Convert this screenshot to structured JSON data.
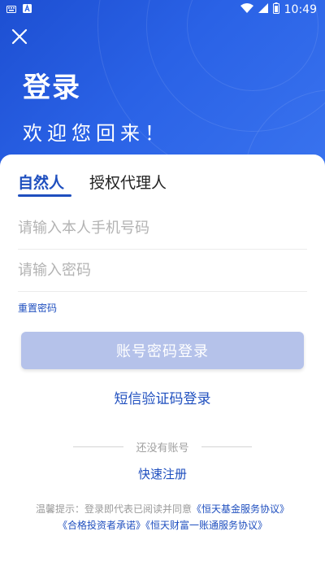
{
  "status_bar": {
    "time": "10:49"
  },
  "header": {
    "title": "登录",
    "subtitle": "欢迎您回来！"
  },
  "tabs": [
    {
      "label": "自然人",
      "active": true
    },
    {
      "label": "授权代理人",
      "active": false
    }
  ],
  "form": {
    "phone_placeholder": "请输入本人手机号码",
    "password_placeholder": "请输入密码",
    "reset_password": "重置密码",
    "login_button": "账号密码登录",
    "sms_login": "短信验证码登录"
  },
  "register": {
    "prompt": "还没有账号",
    "link": "快速注册"
  },
  "agreement": {
    "prefix": "温馨提示：登录即代表已阅读并同意",
    "link1": "《恒天基金服务协议》",
    "link2": "《合格投资者承诺》",
    "link3": "《恒天财富一账通服务协议》"
  },
  "colors": {
    "primary": "#1f4fbf",
    "header_bg": "#2a62e6",
    "button_disabled": "#b5c2ea"
  },
  "icons": [
    "keyboard-icon",
    "a-icon",
    "wifi-icon",
    "cell-signal-icon",
    "battery-icon",
    "close-icon"
  ]
}
